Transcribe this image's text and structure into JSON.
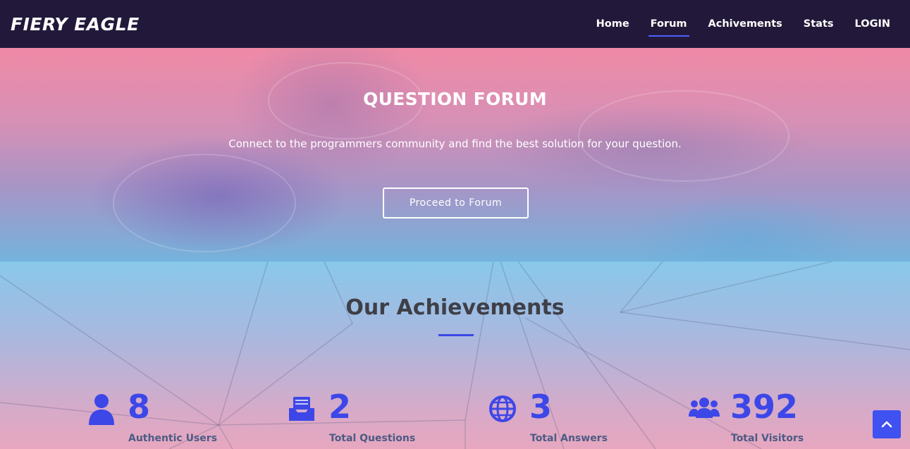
{
  "nav": {
    "brand": "FIERY EAGLE",
    "items": [
      {
        "label": "Home"
      },
      {
        "label": "Forum"
      },
      {
        "label": "Achivements"
      },
      {
        "label": "Stats"
      },
      {
        "label": "LOGIN"
      }
    ],
    "active": "Forum"
  },
  "hero": {
    "title": "QUESTION FORUM",
    "subtitle": "Connect to the programmers community and find the best solution for your question.",
    "button_label": "Proceed to Forum"
  },
  "achievements": {
    "title": "Our Achievements",
    "stats": [
      {
        "icon": "user-icon",
        "value": "8",
        "label": "Authentic Users"
      },
      {
        "icon": "inbox-icon",
        "value": "2",
        "label": "Total Questions"
      },
      {
        "icon": "globe-icon",
        "value": "3",
        "label": "Total Answers"
      },
      {
        "icon": "users-icon",
        "value": "392",
        "label": "Total Visitors"
      }
    ]
  },
  "scroll_top": {
    "icon": "chevron-up-icon"
  },
  "colors": {
    "nav_bg": "#22193a",
    "accent": "#3d47e8",
    "stat_label": "#4c5b86",
    "title": "#3f3f48"
  }
}
